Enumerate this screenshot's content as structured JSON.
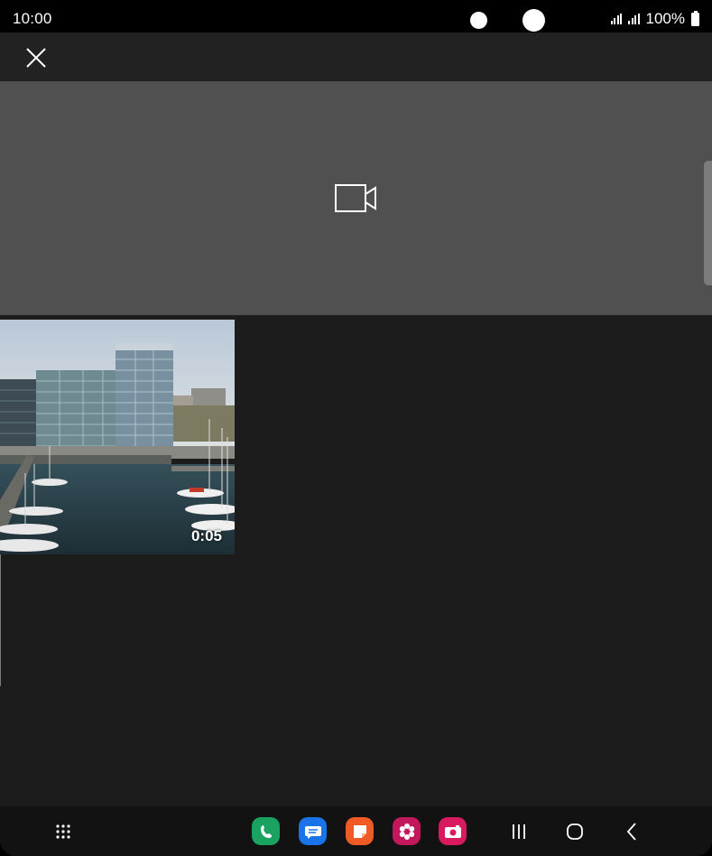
{
  "status_bar": {
    "time": "10:00",
    "battery_text": "100%",
    "icons": [
      "signal-icon",
      "signal-icon",
      "battery-icon"
    ]
  },
  "header": {
    "close_icon": "close-icon"
  },
  "camera_tile": {
    "icon": "video-camera-icon"
  },
  "media": [
    {
      "type": "video",
      "duration": "0:05",
      "thumbnail": "harbor-buildings-marina"
    }
  ],
  "nav_bar": {
    "apps_drawer_icon": "apps-grid-icon",
    "pinned_apps": [
      {
        "name": "phone-app-icon",
        "color": "#1aa260"
      },
      {
        "name": "messages-app-icon",
        "color": "#1a73e8"
      },
      {
        "name": "notes-app-icon",
        "color": "#f05a24"
      },
      {
        "name": "gallery-app-icon",
        "color": "#c2185b"
      },
      {
        "name": "camera-app-icon",
        "color": "#d81b60"
      }
    ],
    "system_buttons": [
      "recents-icon",
      "home-icon",
      "back-icon"
    ]
  }
}
